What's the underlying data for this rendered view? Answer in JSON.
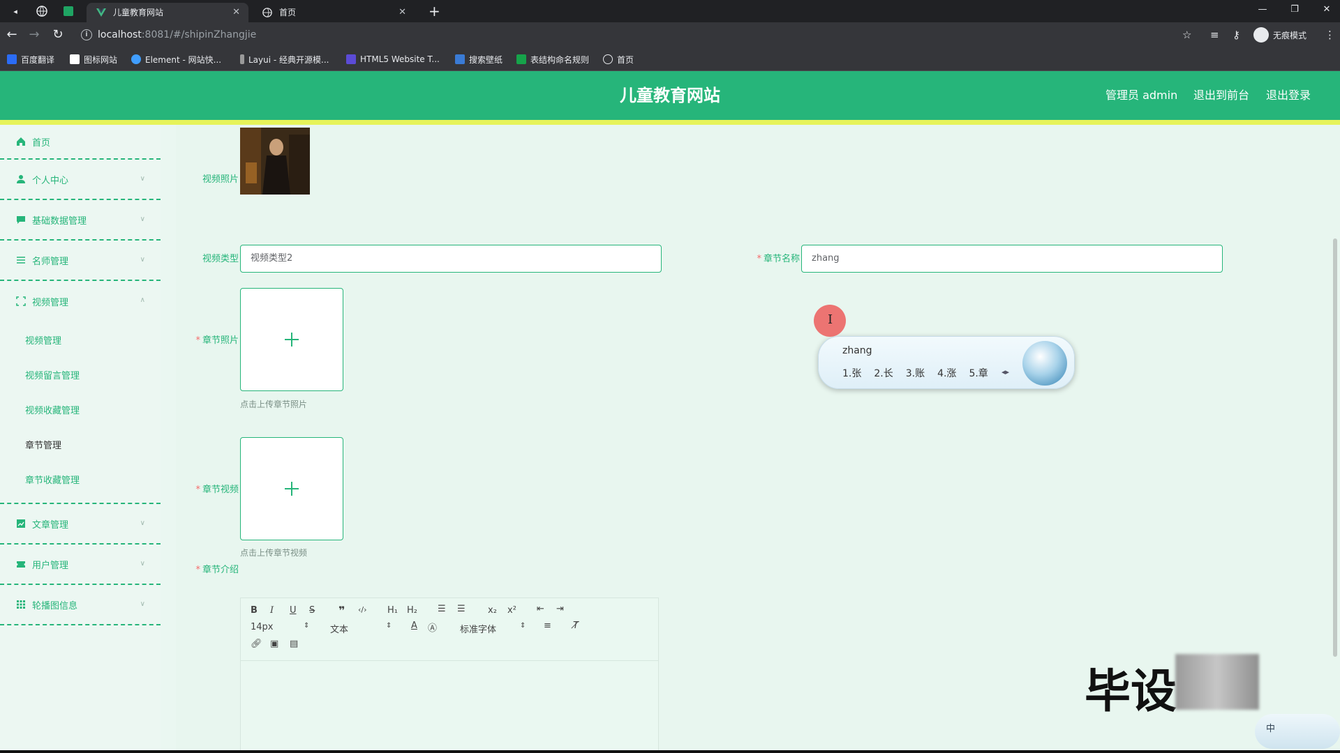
{
  "browser": {
    "tabs": [
      {
        "title": "儿童教育网站",
        "active": true
      },
      {
        "title": "首页",
        "active": false
      }
    ],
    "url_host": "localhost",
    "url_rest": ":8081/#/shipinZhangjie",
    "profile_label": "无痕模式",
    "bookmarks": [
      {
        "label": "百度翻译",
        "color": "#2b6cf5"
      },
      {
        "label": "图标网站",
        "color": "#ffffff"
      },
      {
        "label": "Element - 网站快...",
        "color": "#409eff"
      },
      {
        "label": "Layui - 经典开源模...",
        "color": "#999999"
      },
      {
        "label": "HTML5 Website T...",
        "color": "#5b4bd6"
      },
      {
        "label": "搜索壁纸",
        "color": "#3a7bd5"
      },
      {
        "label": "表结构命名规则",
        "color": "#16a34a"
      },
      {
        "label": "首页",
        "color": "#ffffff"
      }
    ]
  },
  "header": {
    "title": "儿童教育网站",
    "admin": "管理员 admin",
    "to_front": "退出到前台",
    "logout": "退出登录"
  },
  "sidebar": {
    "items": [
      {
        "label": "首页",
        "icon": "home-icon"
      },
      {
        "label": "个人中心",
        "icon": "user-icon"
      },
      {
        "label": "基础数据管理",
        "icon": "chat-icon"
      },
      {
        "label": "名师管理",
        "icon": "list-icon"
      },
      {
        "label": "视频管理",
        "icon": "fullscreen-icon"
      },
      {
        "label": "文章管理",
        "icon": "chart-icon"
      },
      {
        "label": "用户管理",
        "icon": "ticket-icon"
      },
      {
        "label": "轮播图信息",
        "icon": "grid-icon"
      }
    ],
    "video_sub": [
      "视频管理",
      "视频留言管理",
      "视频收藏管理",
      "章节管理",
      "章节收藏管理"
    ]
  },
  "form": {
    "video_photo_label": "视频照片",
    "video_type_label": "视频类型",
    "video_type_value": "视频类型2",
    "chapter_name_label": "章节名称",
    "chapter_name_value": "zhang",
    "chapter_photo_label": "章节照片",
    "chapter_photo_tip": "点击上传章节照片",
    "chapter_video_label": "章节视频",
    "chapter_video_tip": "点击上传章节视频",
    "chapter_intro_label": "章节介绍"
  },
  "editor": {
    "font_size": "14px",
    "header_select": "文本",
    "font_family": "标准字体"
  },
  "ime": {
    "composition": "zhang",
    "candidates": [
      "1.张",
      "2.长",
      "3.账",
      "4.涨",
      "5.章"
    ],
    "status": "中"
  },
  "watermark": "毕设",
  "colors": {
    "accent": "#26b57a",
    "strip": "#e6f35a",
    "background": "#eaf7f1"
  }
}
